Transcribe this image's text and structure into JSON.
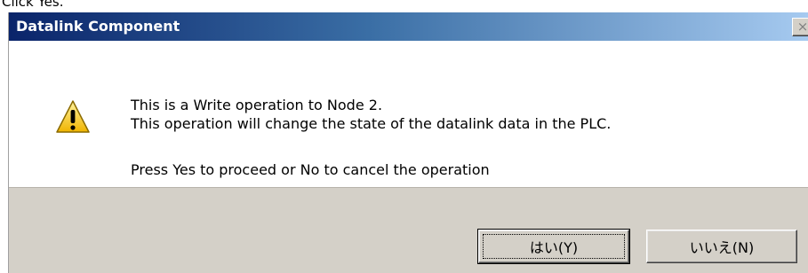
{
  "caption": "Click Yes.",
  "dialog": {
    "title": "Datalink Component",
    "close_symbol": "×",
    "icon": "warning-icon",
    "message_lines": [
      "This is a Write operation to Node 2.",
      "This operation will change the state of the datalink data in the PLC.",
      "Press Yes to proceed or No to cancel the operation"
    ],
    "buttons": {
      "yes_label": "はい(Y)",
      "no_label": "いいえ(N)"
    }
  },
  "colors": {
    "title_gradient_start": "#0a246a",
    "title_gradient_end": "#a6caf0",
    "dialog_face": "#d4d0c8",
    "warning_yellow": "#f7c21f"
  }
}
